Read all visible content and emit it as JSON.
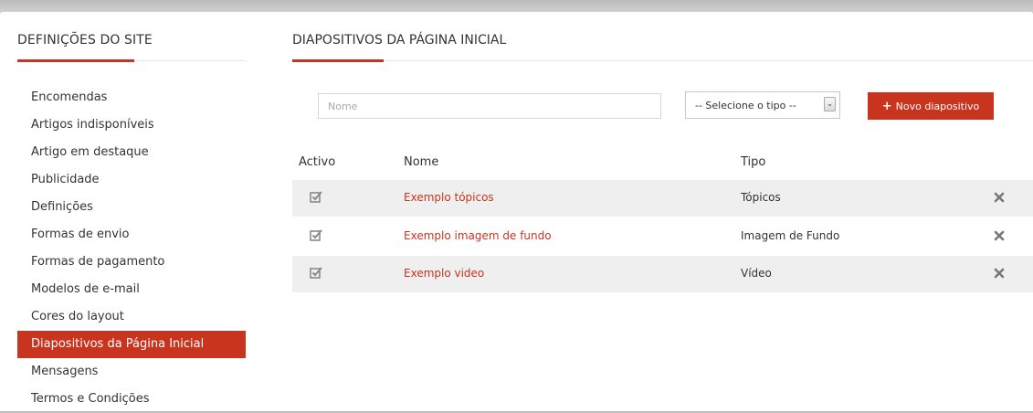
{
  "sidebar": {
    "title": "DEFINIÇÕES DO SITE",
    "items": [
      {
        "label": "Encomendas"
      },
      {
        "label": "Artigos indisponíveis"
      },
      {
        "label": "Artigo em destaque"
      },
      {
        "label": "Publicidade"
      },
      {
        "label": "Definições"
      },
      {
        "label": "Formas de envio"
      },
      {
        "label": "Formas de pagamento"
      },
      {
        "label": "Modelos de e-mail"
      },
      {
        "label": "Cores do layout"
      },
      {
        "label": "Diapositivos da Página Inicial",
        "active": true
      },
      {
        "label": "Mensagens"
      },
      {
        "label": "Termos e Condições"
      }
    ]
  },
  "main": {
    "title": "DIAPOSITIVOS DA PÁGINA INICIAL",
    "filters": {
      "name_placeholder": "Nome",
      "type_select": "-- Selecione o tipo --",
      "new_button": "Novo diapositivo",
      "new_button_icon": "plus-icon"
    },
    "table": {
      "headers": {
        "active": "Activo",
        "name": "Nome",
        "type": "Tipo"
      },
      "rows": [
        {
          "name": "Exemplo tópicos",
          "type": "Tópicos",
          "active": true
        },
        {
          "name": "Exemplo imagem de fundo",
          "type": "Imagem de Fundo",
          "active": true
        },
        {
          "name": "Exemplo video",
          "type": "Vídeo",
          "active": true
        }
      ]
    }
  },
  "colors": {
    "accent": "#c9341e",
    "row_shade": "#efefef",
    "icon_gray": "#8a8a8a"
  }
}
